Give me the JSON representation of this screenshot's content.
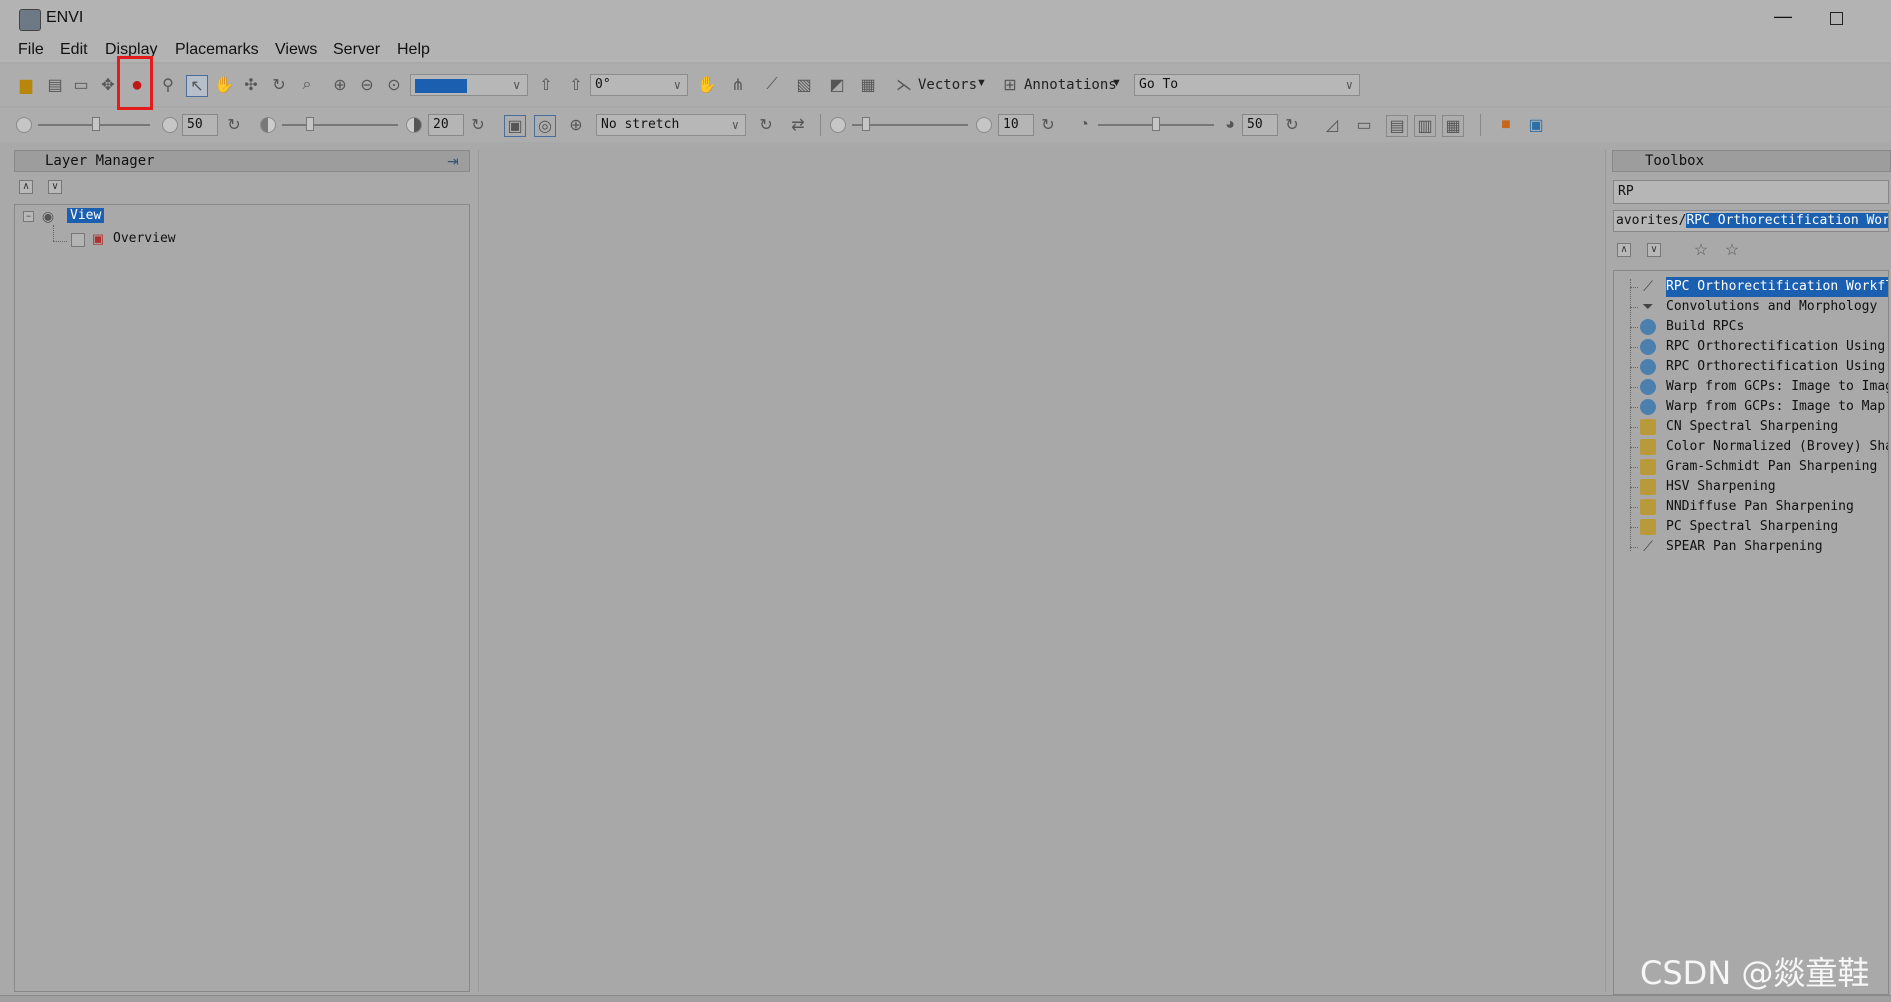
{
  "window": {
    "title": "ENVI"
  },
  "menu": [
    "File",
    "Edit",
    "Display",
    "Placemarks",
    "Views",
    "Server",
    "Help"
  ],
  "toolbar1": {
    "rotation_value": "0°",
    "vectors_label": "Vectors",
    "annotations_label": "Annotations",
    "goto_value": "Go To"
  },
  "toolbar2": {
    "brightness_value": "50",
    "contrast_value": "20",
    "stretch_value": "No stretch",
    "sharpen_value": "10",
    "transparency_value": "50"
  },
  "layer_manager": {
    "title": "Layer Manager",
    "tree": {
      "root": "View",
      "child": "Overview"
    }
  },
  "toolbox": {
    "title": "Toolbox",
    "search_value": "RP",
    "path_prefix": "avorites/",
    "path_selected": "RPC Orthorectification Workfl",
    "items": [
      {
        "label": "RPC Orthorectification Workflo",
        "icon": "wand",
        "selected": true
      },
      {
        "label": "Convolutions and Morphology",
        "icon": "filter"
      },
      {
        "label": "Build RPCs",
        "icon": "globe"
      },
      {
        "label": "RPC Orthorectification Using D",
        "icon": "globe"
      },
      {
        "label": "RPC Orthorectification Using R",
        "icon": "globe"
      },
      {
        "label": "Warp from GCPs: Image to Image",
        "icon": "globe"
      },
      {
        "label": "Warp from GCPs: Image to Map R",
        "icon": "globe"
      },
      {
        "label": "CN Spectral Sharpening",
        "icon": "folder"
      },
      {
        "label": "Color Normalized (Brovey) Shar",
        "icon": "folder"
      },
      {
        "label": "Gram-Schmidt Pan Sharpening",
        "icon": "folder"
      },
      {
        "label": "HSV Sharpening",
        "icon": "folder"
      },
      {
        "label": "NNDiffuse Pan Sharpening",
        "icon": "folder"
      },
      {
        "label": "PC Spectral Sharpening",
        "icon": "folder"
      },
      {
        "label": "SPEAR Pan Sharpening",
        "icon": "spear"
      }
    ]
  },
  "watermark": "CSDN @燚童鞋",
  "colors": {
    "highlight": "#e31b1b",
    "selection": "#1b5fb0"
  }
}
